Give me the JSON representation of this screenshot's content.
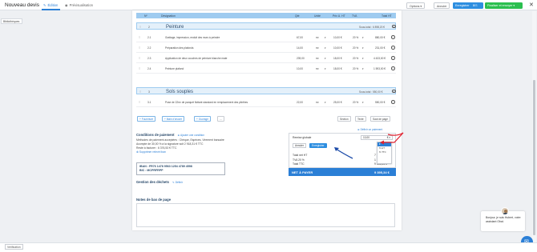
{
  "header": {
    "title": "Nouveau devis",
    "tab_edit": "Édition",
    "tab_preview": "Prévisualisation",
    "options_label": "Options",
    "cancel_label": "Annuler",
    "save_label": "Enregistrer",
    "save_shortcut": "⌘S",
    "finalize_label": "Finaliser et envoyer",
    "close_label": "✕"
  },
  "sidebar": {
    "tag_label": "Bibliothèques"
  },
  "table": {
    "headers": [
      "Nº",
      "Désignation",
      "Qté",
      "Unité",
      "Prix U. HT",
      "TVA",
      "Total HT"
    ],
    "sections": [
      {
        "num": "2",
        "name": "Peinture",
        "subtotal": "Sous-total : 6 898,20 €",
        "rows": [
          {
            "num": "2.1",
            "desc": "Grattage, impression, enduit des murs à peindre",
            "qty": "67,00",
            "unit": "m²",
            "price": "10,00 €",
            "tva": "20 %",
            "total": "880,00 €"
          },
          {
            "num": "2.2",
            "desc": "Préparation des plafonds",
            "qty": "14,00",
            "unit": "m²",
            "price": "10,00 €",
            "tva": "20 %",
            "total": "231,00 €"
          },
          {
            "num": "2.3",
            "desc": "Application de deux couches de peinture blanche mate",
            "qty": "239,00",
            "unit": "m²",
            "price": "18,00 €",
            "tva": "20 %",
            "total": "4 433,00 €"
          },
          {
            "num": "2.4",
            "desc": "Peinture plafond",
            "qty": "10,00",
            "unit": "m²",
            "price": "18,00 €",
            "tva": "20 %",
            "total": "1 593,00 €"
          }
        ]
      },
      {
        "num": "3",
        "name": "Sols souples",
        "subtotal": "Sous-total : 550,00 €",
        "rows": [
          {
            "num": "3.1",
            "desc": "Pose de 22m² de parquet flottant standard en remplacement des plinthes",
            "qty": "22,00",
            "unit": "m²",
            "price": "25,00 €",
            "tva": "20 %",
            "total": "550,00 €"
          }
        ]
      }
    ]
  },
  "actions": {
    "add_product": "+ Fourniture",
    "add_labor": "+ Main d'œuvre",
    "add_work": "+ Ouvrage",
    "more": "...",
    "section": "Section",
    "text": "Texte",
    "page_break": "Saut de page"
  },
  "payment": {
    "title": "Conditions de paiement",
    "add_condition": "Ajouter une condition",
    "methods": "Méthodes de paiement acceptées : Chèque, Espèces, Virement bancaire",
    "deposit": "Acompte de 30,00 % à la signature soit 2 918,31 € TTC",
    "remaining": "Reste à facturer : 6 376,53 € TTC",
    "delete_bank": "Supprimer relevé iban",
    "iban": "IBAN : FR76 1478 9563 1254 4789 4598",
    "bic": "BIC : MCPRFRPP"
  },
  "waste": {
    "title": "Gestion des déchets",
    "define": "Définir"
  },
  "notes": {
    "title": "Notes de bas de page"
  },
  "totals": {
    "define_payment": "Définir un paiement",
    "global_discount_label": "Remise globale",
    "discount_value": "10,00",
    "cancel_label": "Annuler",
    "save_label": "Enregistrer",
    "ht_label": "Total net HT",
    "ht_value": "7 800,00 €",
    "tva_label": "TVA 20 %",
    "tva_value": "1 593,94 €",
    "ttc_label": "Total TTC",
    "ttc_value": "9 395,34 €",
    "net_label": "NET À PAYER",
    "net_value": "9 395,34 €",
    "dropdown_options": [
      "€",
      "% HT",
      "% TTC"
    ],
    "dropdown_selected": "€"
  },
  "chat": {
    "message_line1": "Bonjour, je suis Hubert, votre",
    "message_line2": "assistant Obat."
  },
  "bottom": {
    "tag_label": "Verification"
  },
  "colors": {
    "accent": "#2b7fd6",
    "green": "#2bbf4f",
    "table_header": "#9ecbf0",
    "annotation": "#e0202e"
  }
}
